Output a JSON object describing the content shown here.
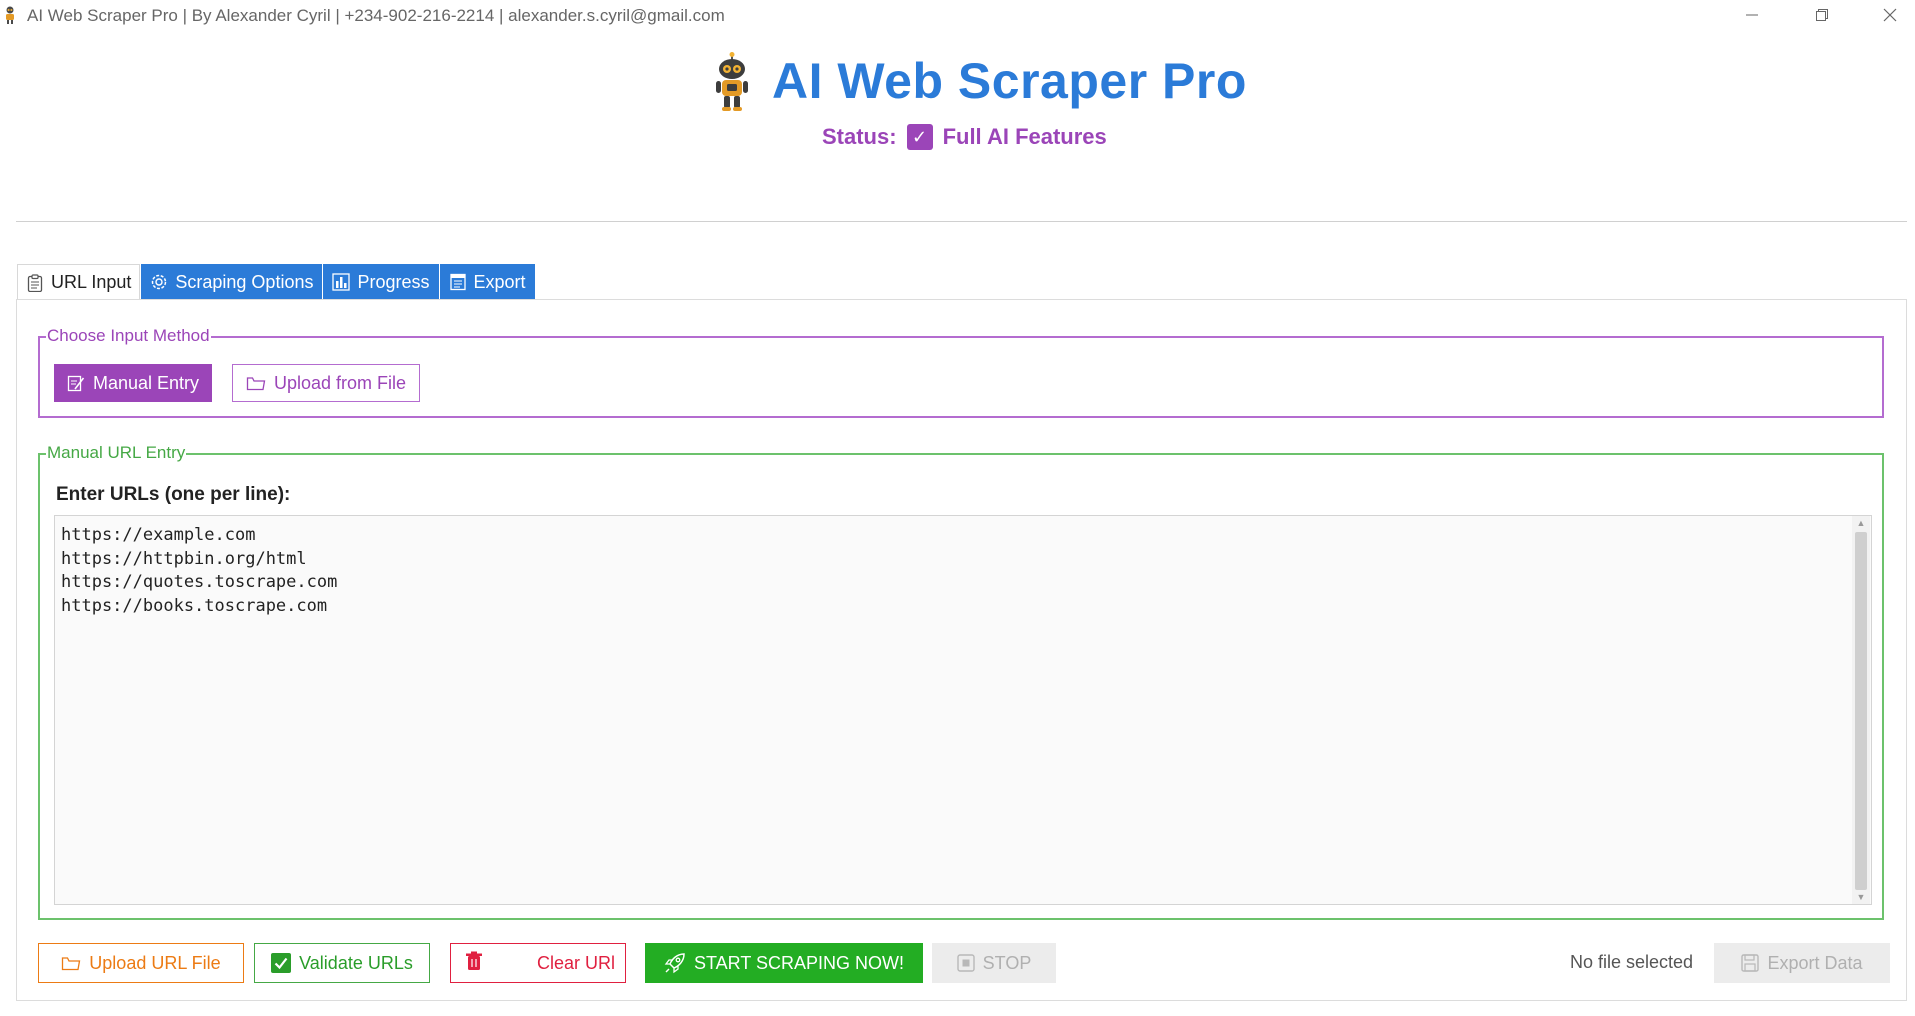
{
  "window": {
    "title": "AI Web Scraper Pro | By Alexander Cyril | +234-902-216-2214 | alexander.s.cyril@gmail.com",
    "minimize_icon": "minimize-icon",
    "maximize_icon": "restore-icon",
    "close_icon": "close-icon"
  },
  "header": {
    "logo_icon": "robot-icon",
    "title": "AI Web Scraper Pro",
    "status_label": "Status:",
    "status_value": "Full AI Features",
    "status_icon": "checkmark-icon"
  },
  "tabs": [
    {
      "label": "URL Input",
      "icon": "clipboard-icon",
      "active": true
    },
    {
      "label": "Scraping Options",
      "icon": "gear-icon",
      "active": false
    },
    {
      "label": "Progress",
      "icon": "bar-chart-icon",
      "active": false
    },
    {
      "label": "Export",
      "icon": "document-icon",
      "active": false
    }
  ],
  "input_method": {
    "group_label": "Choose Input Method",
    "manual_label": "Manual Entry",
    "upload_label": "Upload from File",
    "selected": "Manual Entry"
  },
  "manual_entry": {
    "group_label": "Manual URL Entry",
    "prompt": "Enter URLs (one per line):",
    "urls": [
      "https://example.com",
      "https://httpbin.org/html",
      "https://quotes.toscrape.com",
      "https://books.toscrape.com"
    ]
  },
  "actions": {
    "upload_url_file": "Upload URL File",
    "validate_urls": "Validate URLs",
    "clear_urls": "Clear URl",
    "start": "START SCRAPING NOW!",
    "stop": "STOP",
    "file_status": "No file selected",
    "export": "Export Data"
  },
  "colors": {
    "accent_blue": "#2b7bd8",
    "purple": "#9b45b8",
    "green": "#23ad23",
    "orange": "#ec7b14",
    "red": "#e02040",
    "disabled": "#ececec"
  }
}
